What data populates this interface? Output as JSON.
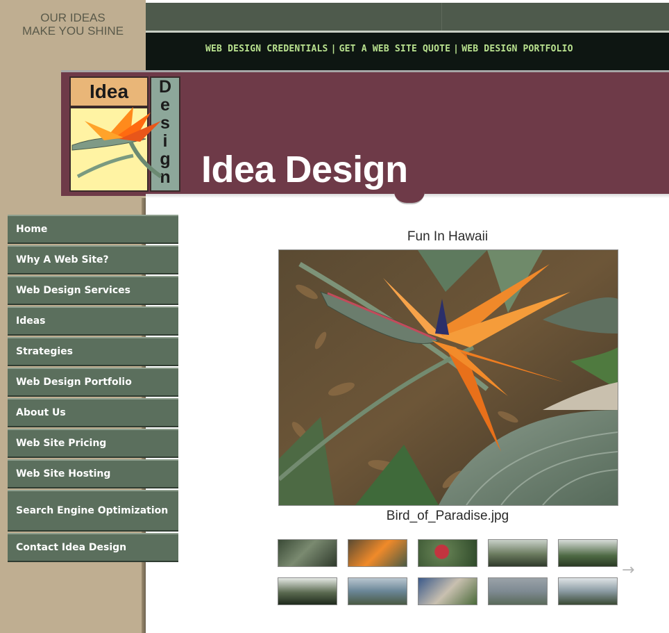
{
  "tagline": "OUR IDEAS\nMAKE YOU SHINE",
  "top_nav": {
    "items": [
      "WEB DESIGN CREDENTIALS",
      "GET A WEB SITE QUOTE",
      "WEB DESIGN PORTFOLIO"
    ],
    "separator": "|"
  },
  "logo": {
    "word1": "Idea",
    "word2_letters": [
      "D",
      "e",
      "s",
      "i",
      "g",
      "n"
    ]
  },
  "banner": {
    "title": "Idea Design",
    "color": "#6e3a48"
  },
  "menu": {
    "items": [
      "Home",
      "Why A Web Site?",
      "Web Design Services",
      "Ideas",
      "Strategies",
      "Web Design Portfolio",
      "About Us",
      "Web Site Pricing",
      "Web Site Hosting",
      "Search Engine Optimization",
      "Contact Idea Design"
    ],
    "color": "#5b6f5d"
  },
  "gallery": {
    "title": "Fun In Hawaii",
    "caption": "Bird_of_Paradise.jpg",
    "next_icon": "arrow-right-icon",
    "next_glyph": "→"
  }
}
